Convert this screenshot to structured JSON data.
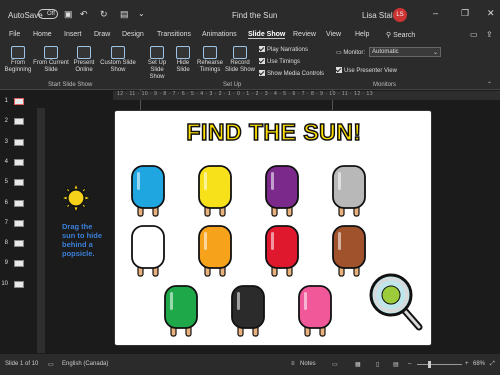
{
  "titlebar": {
    "autosave": "AutoSave",
    "autosave_state": "Off",
    "doc_title": "Find the Sun",
    "user": "Lisa Staley",
    "initials": "LS"
  },
  "tabs": [
    "File",
    "Home",
    "Insert",
    "Draw",
    "Design",
    "Transitions",
    "Animations",
    "Slide Show",
    "Review",
    "View",
    "Help"
  ],
  "active_tab": "Slide Show",
  "search": "Search",
  "ribbon": {
    "start": {
      "from_beginning": "From Beginning",
      "from_current": "From Current Slide",
      "present_online": "Present Online",
      "custom_show": "Custom Slide Show",
      "group": "Start Slide Show"
    },
    "setup": {
      "setup": "Set Up Slide Show",
      "hide": "Hide Slide",
      "rehearse": "Rehearse Timings",
      "record": "Record Slide Show",
      "play_narrations": "Play Narrations",
      "use_timings": "Use Timings",
      "show_media": "Show Media Controls",
      "group": "Set Up"
    },
    "monitors": {
      "monitor_label": "Monitor:",
      "monitor_value": "Automatic",
      "presenter_view": "Use Presenter View",
      "group": "Monitors"
    }
  },
  "ruler": "12 · 11 · 10 · 9 · 8 · 7 · 6 · 5 · 4 · 3 · 2 · 1 · 0 · 1 · 2 · 3 · 4 · 5 · 6 · 7 · 8 · 9 · 10 · 11 · 12 · 13",
  "thumbnails": [
    "1",
    "2",
    "3",
    "4",
    "5",
    "6",
    "7",
    "8",
    "9",
    "10"
  ],
  "selected_thumbnail": "1",
  "slide": {
    "title": "FIND THE SUN!",
    "instruction": "Drag the sun to hide behind a popsicle.",
    "popsicle_colors": [
      "#1fa6e0",
      "#f7e11b",
      "#7b2a8c",
      "#b8b8b8",
      "#ffffff",
      "#f7a21b",
      "#e0182d",
      "#a0522d",
      "#1fa84a",
      "#2b2b2b",
      "#f0589a"
    ]
  },
  "status": {
    "slide": "Slide 1 of 10",
    "language": "English (Canada)",
    "notes": "Notes",
    "zoom": "68%"
  }
}
